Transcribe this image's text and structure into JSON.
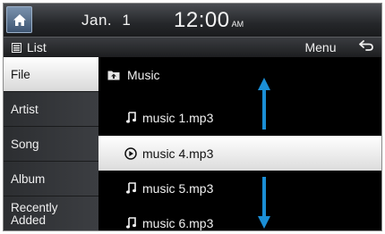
{
  "status": {
    "date_month": "Jan.",
    "date_day": "1",
    "time": "12:00",
    "ampm": "AM"
  },
  "header": {
    "list_label": "List",
    "menu_label": "Menu"
  },
  "sidebar": {
    "items": [
      {
        "label": "File",
        "active": true
      },
      {
        "label": "Artist",
        "active": false
      },
      {
        "label": "Song",
        "active": false
      },
      {
        "label": "Album",
        "active": false
      },
      {
        "label": "Recently Added",
        "line1": "Recently",
        "line2": "Added",
        "active": false
      }
    ]
  },
  "list": {
    "folder": "Music",
    "tracks": [
      {
        "name": "music 1.mp3",
        "playing": false
      },
      {
        "name": "music 4.mp3",
        "playing": true
      },
      {
        "name": "music 5.mp3",
        "playing": false
      },
      {
        "name": "music 6.mp3",
        "playing": false
      }
    ]
  },
  "icons": {
    "home": "home-icon",
    "list": "list-icon",
    "back": "back-arrow-icon",
    "folder": "folder-up-icon",
    "note": "music-note-icon",
    "play": "play-circle-icon",
    "scroll_up": "scroll-up-arrow-icon",
    "scroll_down": "scroll-down-arrow-icon"
  },
  "colors": {
    "accent_arrow": "#1b8fd6",
    "selection": "#ffffff",
    "background": "#000000"
  }
}
